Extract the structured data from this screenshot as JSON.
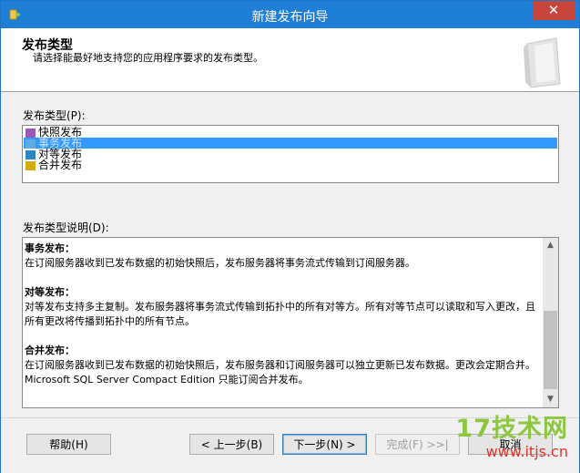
{
  "window": {
    "title": "新建发布向导",
    "close_symbol": "✕"
  },
  "header": {
    "title": "发布类型",
    "subtitle": "请选择能最好地支持您的应用程序要求的发布类型。"
  },
  "publication_types": {
    "label": "发布类型(P):",
    "items": [
      {
        "label": "快照发布",
        "icon": "snapshot-publication-icon",
        "selected": false
      },
      {
        "label": "事务发布",
        "icon": "transactional-publication-icon",
        "selected": true
      },
      {
        "label": "对等发布",
        "icon": "peer-to-peer-publication-icon",
        "selected": false
      },
      {
        "label": "合并发布",
        "icon": "merge-publication-icon",
        "selected": false
      }
    ]
  },
  "description": {
    "label": "发布类型说明(D):",
    "sections": [
      {
        "head": "事务发布：",
        "body": "在订阅服务器收到已发布数据的初始快照后，发布服务器将事务流式传输到订阅服务器。"
      },
      {
        "head": "对等发布：",
        "body": "对等发布支持多主复制。发布服务器将事务流式传输到拓扑中的所有对等方。所有对等节点可以读取和写入更改，且所有更改将传播到拓扑中的所有节点。"
      },
      {
        "head": "合并发布：",
        "body": "在订阅服务器收到已发布数据的初始快照后，发布服务器和订阅服务器可以独立更新已发布数据。更改会定期合并。Microsoft SQL Server Compact Edition 只能订阅合并发布。"
      }
    ]
  },
  "buttons": {
    "help": "帮助(H)",
    "back": "< 上一步(B)",
    "next": "下一步(N) >",
    "finish": "完成(F) >>|",
    "cancel": "取消"
  },
  "watermark": {
    "brand": "17技术网",
    "url": "www.itjs.cn"
  },
  "colors": {
    "titlebar": "#1f7fd7",
    "selection": "#3399ff",
    "close": "#c7453a"
  }
}
